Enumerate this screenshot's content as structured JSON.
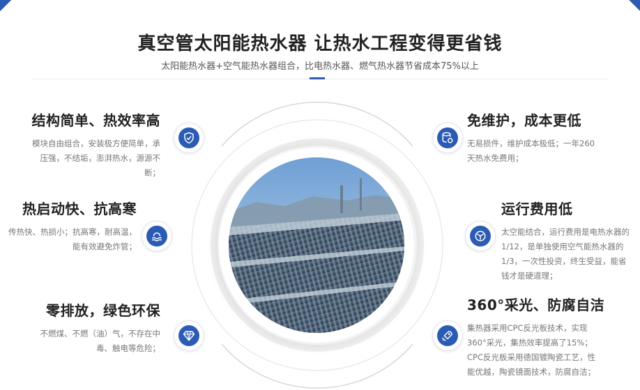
{
  "header": {
    "title": "真空管太阳能热水器 让热水工程变得更省钱",
    "subtitle": "太阳能热水器+空气能热水器组合，比电热水器、燃气热水器节省成本75%以上"
  },
  "accent_color": "#2b5bb3",
  "features_left": [
    {
      "title": "结构简单、热效率高",
      "lines": [
        "模块自由组合，安装极方便简单，承",
        "压强，不结垢，澎湃热水，源源不",
        "断；"
      ],
      "icon": "shield-check-icon"
    },
    {
      "title": "热启动快、抗高寒",
      "lines": [
        "传热快、热损小；抗高寒，耐高温，",
        "能有效避免炸管；"
      ],
      "icon": "heat-waves-icon"
    },
    {
      "title": "零排放，绿色环保",
      "lines": [
        "不燃煤、不燃（油）气，不存在中",
        "毒、触电等危险；"
      ],
      "icon": "diamond-icon"
    }
  ],
  "features_right": [
    {
      "title": "免维护，成本更低",
      "lines": [
        "无易损件，维护成本极低；一年260",
        "天热水免费用；"
      ],
      "icon": "database-coin-icon"
    },
    {
      "title": "运行费用低",
      "lines": [
        "太空能结合，运行费用是电热水器的",
        "1/12，是单独使用空气能热水器的",
        "1/3，一次性投资，终生受益，能省",
        "钱才是硬道理；"
      ],
      "icon": "fan-icon"
    },
    {
      "title": "360°采光、防腐自洁",
      "lines": [
        "集热器采用CPC反光板技术，实现",
        "360°采光，集热效率提高了15%；",
        "CPC反光板采用德国镀陶瓷工艺，性",
        "能优越，陶瓷镜面技术，防腐自洁；"
      ],
      "icon": "rocket-icon"
    }
  ]
}
